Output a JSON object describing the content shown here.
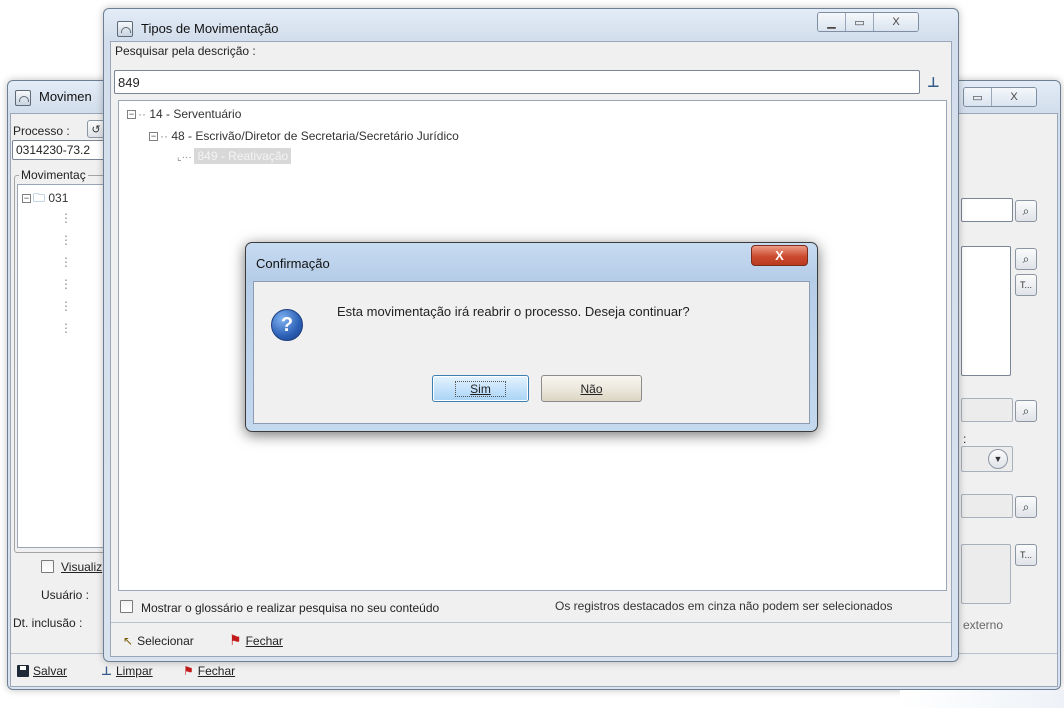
{
  "back_window": {
    "title": "Movimen",
    "processo_label": "Processo :",
    "processo_value": "0314230-73.2",
    "movimentacao_label": "Movimentaç",
    "tree_root_text": "031",
    "visualizar_label": "Visualiz",
    "usuario_label": "Usuário :",
    "dt_inclusao_label": "Dt. inclusão :",
    "externo_text": "externo",
    "toolbar": {
      "salvar": "Salvar",
      "limpar": "Limpar",
      "fechar": "Fechar"
    }
  },
  "tipos_window": {
    "title": "Tipos de Movimentação",
    "search_label": "Pesquisar pela descrição :",
    "search_value": "849",
    "tree": [
      {
        "text": "14 - Serventuário"
      },
      {
        "text": "48 - Escrivão/Diretor de Secretaria/Secretário Jurídico"
      },
      {
        "text": "849 - Reativação"
      }
    ],
    "glossario_label": "Mostrar o glossário e realizar pesquisa no seu conteúdo",
    "note": "Os registros destacados em cinza não podem ser selecionados",
    "toolbar": {
      "selecionar": "Selecionar",
      "fechar": "Fechar"
    }
  },
  "dialog": {
    "title": "Confirmação",
    "message": "Esta movimentação irá reabrir o processo. Deseja continuar?",
    "yes_label": "Sim",
    "no_label": "Não"
  },
  "icons": {
    "question": "?",
    "close": "X",
    "search": "search-icon",
    "text": "T..."
  },
  "colors": {
    "selected_node": "#d8d8d8",
    "dialog_title": "#c7dbf1",
    "yes_button": "#c6e3fb",
    "no_button": "#ece8dd"
  }
}
